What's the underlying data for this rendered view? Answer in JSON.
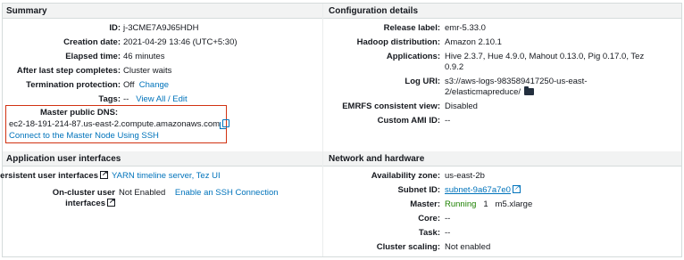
{
  "summary": {
    "title": "Summary",
    "id_label": "ID:",
    "id_value": "j-3CME7A9J65HDH",
    "created_label": "Creation date:",
    "created_value": "2021-04-29 13:46 (UTC+5:30)",
    "elapsed_label": "Elapsed time:",
    "elapsed_value": "46 minutes",
    "after_step_label": "After last step completes:",
    "after_step_value": "Cluster waits",
    "termination_label": "Termination protection:",
    "termination_value": "Off",
    "termination_link": "Change",
    "tags_label": "Tags:",
    "tags_value": "--",
    "tags_link": "View All / Edit",
    "dns_label": "Master public DNS:",
    "dns_value": "ec2-18-191-214-87.us-east-2.compute.amazonaws.com",
    "ssh_link": "Connect to the Master Node Using SSH"
  },
  "app_interfaces": {
    "title": "Application user interfaces",
    "persistent_label": "Persistent user interfaces",
    "persistent_link": "YARN timeline server, Tez UI",
    "oncluster_label_1": "On-cluster user",
    "oncluster_label_2": "interfaces",
    "oncluster_value": "Not Enabled",
    "oncluster_link": "Enable an SSH Connection"
  },
  "config": {
    "title": "Configuration details",
    "release_label": "Release label:",
    "release_value": "emr-5.33.0",
    "hadoop_label": "Hadoop distribution:",
    "hadoop_value": "Amazon 2.10.1",
    "apps_label": "Applications:",
    "apps_value_1": "Hive 2.3.7, Hue 4.9.0, Mahout 0.13.0, Pig 0.17.0, Tez",
    "apps_value_2": "0.9.2",
    "log_label": "Log URI:",
    "log_value_1": "s3://aws-logs-983589417250-us-east-",
    "log_value_2": "2/elasticmapreduce/",
    "emrfs_label": "EMRFS consistent view:",
    "emrfs_value": "Disabled",
    "ami_label": "Custom AMI ID:",
    "ami_value": "--"
  },
  "network": {
    "title": "Network and hardware",
    "az_label": "Availability zone:",
    "az_value": "us-east-2b",
    "subnet_label": "Subnet ID:",
    "subnet_value": "subnet-9a67a7e0",
    "master_label": "Master:",
    "master_status": "Running",
    "master_count": "1",
    "master_type": "m5.xlarge",
    "core_label": "Core:",
    "core_value": "--",
    "task_label": "Task:",
    "task_value": "--",
    "scaling_label": "Cluster scaling:",
    "scaling_value": "Not enabled"
  }
}
